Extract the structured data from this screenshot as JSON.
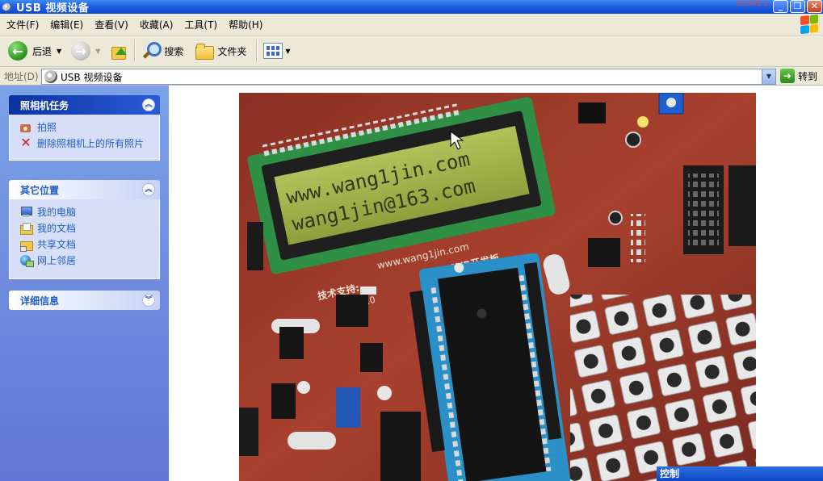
{
  "window": {
    "title": "USB 视频设备",
    "corner_stamp": "ESCAPE-C...",
    "buttons": {
      "minimize": "_",
      "maximize": "❐",
      "close": "✕"
    }
  },
  "menu": [
    "文件(F)",
    "编辑(E)",
    "查看(V)",
    "收藏(A)",
    "工具(T)",
    "帮助(H)"
  ],
  "toolbar": {
    "back_label": "后退",
    "search_label": "搜索",
    "folders_label": "文件夹"
  },
  "address": {
    "label": "地址(D)",
    "value": "USB 视频设备",
    "go_label": "转到"
  },
  "taskpane": {
    "camera_tasks": {
      "title": "照相机任务",
      "items": [
        "拍照",
        "删除照相机上的所有照片"
      ]
    },
    "other_places": {
      "title": "其它位置",
      "items": [
        "我的电脑",
        "我的文档",
        "共享文档",
        "网上邻居"
      ]
    },
    "details": {
      "title": "详细信息"
    }
  },
  "video": {
    "lcd_line1": "www.wang1jin.com",
    "lcd_line2": "wang1jin@163.com",
    "board_url": "www.wang1jin.com",
    "board_support": "技术支持:",
    "board_model": "51+AVR开发板",
    "board_version": "RJ-V4.0"
  },
  "control_bar": {
    "label": "控制"
  },
  "colors": {
    "title_blue": "#0b47d1",
    "taskpane_blue": "#7ba2e7",
    "pcb_red": "#9c3a2a",
    "lcd_green": "#a6ba4a"
  }
}
